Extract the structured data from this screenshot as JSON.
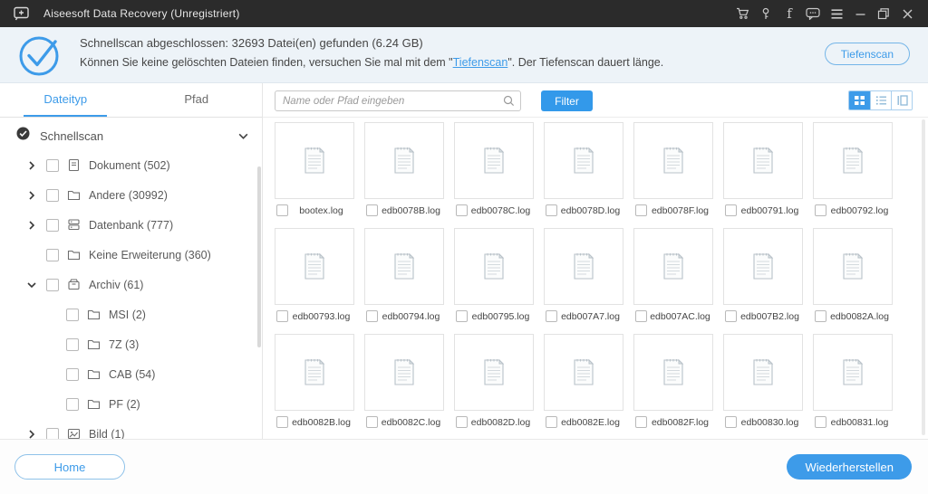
{
  "title_bar": {
    "app_title": "Aiseesoft Data Recovery (Unregistriert)",
    "icons": [
      "cart-icon",
      "key-icon",
      "facebook-icon",
      "feedback-chat-icon",
      "menu-icon",
      "minimize-icon",
      "restore-icon",
      "close-icon"
    ]
  },
  "header": {
    "scan_result": "Schnellscan abgeschlossen: 32693 Datei(en) gefunden (6.24 GB)",
    "hint_prefix": "Können Sie keine gelöschten Dateien finden, versuchen Sie mal mit dem \"",
    "hint_link": "Tiefenscan",
    "hint_suffix": "\". Der Tiefenscan dauert länge.",
    "deep_scan_button": "Tiefenscan"
  },
  "sidebar": {
    "tabs": [
      {
        "label": "Dateityp",
        "active": true
      },
      {
        "label": "Pfad",
        "active": false
      }
    ],
    "root_label": "Schnellscan",
    "items": [
      {
        "label": "Dokument",
        "count": "502",
        "icon": "document",
        "chevron": "right",
        "indent": 0
      },
      {
        "label": "Andere",
        "count": "30992",
        "icon": "folder",
        "chevron": "right",
        "indent": 0
      },
      {
        "label": "Datenbank",
        "count": "777",
        "icon": "database",
        "chevron": "right",
        "indent": 0
      },
      {
        "label": "Keine Erweiterung",
        "count": "360",
        "icon": "folder",
        "chevron": "none",
        "indent": 0
      },
      {
        "label": "Archiv",
        "count": "61",
        "icon": "archive",
        "chevron": "down",
        "indent": 0
      },
      {
        "label": "MSI",
        "count": "2",
        "icon": "folder",
        "chevron": "none",
        "indent": 1
      },
      {
        "label": "7Z",
        "count": "3",
        "icon": "folder",
        "chevron": "none",
        "indent": 1
      },
      {
        "label": "CAB",
        "count": "54",
        "icon": "folder",
        "chevron": "none",
        "indent": 1
      },
      {
        "label": "PF",
        "count": "2",
        "icon": "folder",
        "chevron": "none",
        "indent": 1
      },
      {
        "label": "Bild",
        "count": "1",
        "icon": "image",
        "chevron": "right",
        "indent": 0
      }
    ]
  },
  "toolbar": {
    "search_placeholder": "Name oder Pfad eingeben",
    "filter_button": "Filter",
    "view_modes": [
      "grid",
      "list",
      "detail"
    ]
  },
  "files": [
    "bootex.log",
    "edb0078B.log",
    "edb0078C.log",
    "edb0078D.log",
    "edb0078F.log",
    "edb00791.log",
    "edb00792.log",
    "edb00793.log",
    "edb00794.log",
    "edb00795.log",
    "edb007A7.log",
    "edb007AC.log",
    "edb007B2.log",
    "edb0082A.log",
    "edb0082B.log",
    "edb0082C.log",
    "edb0082D.log",
    "edb0082E.log",
    "edb0082F.log",
    "edb00830.log",
    "edb00831.log"
  ],
  "footer": {
    "home_button": "Home",
    "recover_button": "Wiederherstellen"
  },
  "colors": {
    "accent": "#3d9be9",
    "titlebar_bg": "#2b2b2b",
    "header_bg": "#edf3f8",
    "filter_button_bg": "#3399ea"
  }
}
